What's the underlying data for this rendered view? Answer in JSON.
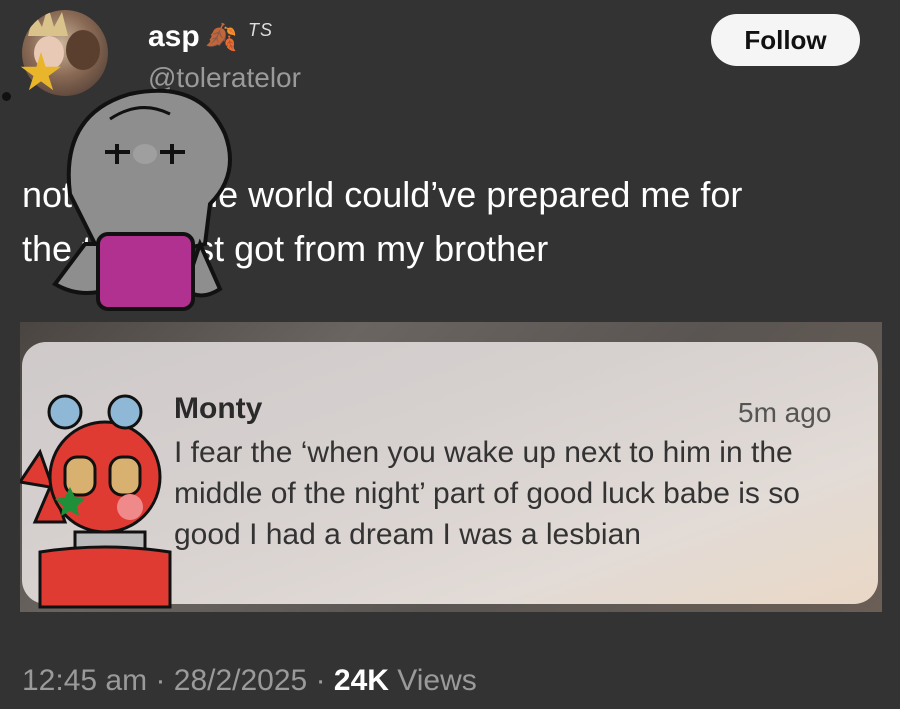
{
  "author": {
    "display_name": "asp",
    "badge_text": "TS",
    "handle": "@toleratelor"
  },
  "follow_label": "Follow",
  "tweet": {
    "text_line1": "nothing in the world could’ve prepared me for",
    "text_line2": "the text i just got from my brother"
  },
  "notification": {
    "sender": "Monty",
    "time": "5m ago",
    "message": "I fear the ‘when you wake up next to him in the middle of the night’ part of good luck babe is so good I had a dream I was a lesbian"
  },
  "meta": {
    "time": "12:45 am",
    "date": "28/2/2025",
    "views_count": "24K",
    "views_label": "Views"
  },
  "colors": {
    "background": "#333333",
    "doodle_shirt_pink": "#b0318f",
    "doodle_red": "#e03b33"
  }
}
